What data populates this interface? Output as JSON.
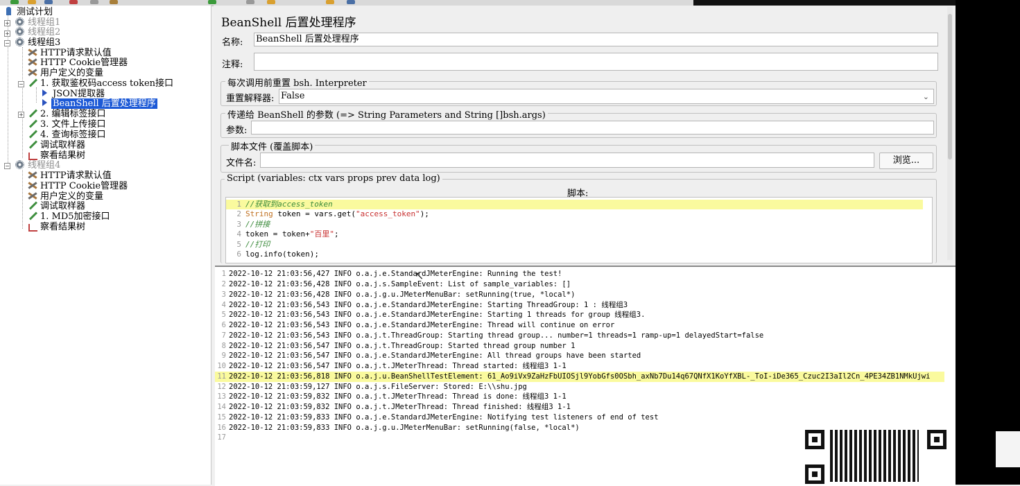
{
  "tree": {
    "items": [
      {
        "label": "测试计划",
        "icon": "test-plan-icon"
      },
      {
        "label": "线程组1",
        "icon": "gear-icon"
      },
      {
        "label": "线程组2",
        "icon": "gear-icon"
      },
      {
        "label": "线程组3",
        "icon": "gear-icon"
      },
      {
        "label": "HTTP请求默认值",
        "icon": "wrench-icon"
      },
      {
        "label": "HTTP Cookie管理器",
        "icon": "wrench-icon"
      },
      {
        "label": "用户定义的变量",
        "icon": "wrench-icon"
      },
      {
        "label": "1. 获取鉴权码access token接口",
        "icon": "sampler-icon"
      },
      {
        "label": "JSON提取器",
        "icon": "postprocessor-icon"
      },
      {
        "label": "BeanShell 后置处理程序",
        "icon": "postprocessor-icon"
      },
      {
        "label": "2. 编辑标签接口",
        "icon": "sampler-icon"
      },
      {
        "label": "3. 文件上传接口",
        "icon": "sampler-icon"
      },
      {
        "label": "4. 查询标签接口",
        "icon": "sampler-icon"
      },
      {
        "label": "调试取样器",
        "icon": "sampler-icon"
      },
      {
        "label": "察看结果树",
        "icon": "listener-icon"
      },
      {
        "label": "线程组4",
        "icon": "gear-icon"
      },
      {
        "label": "HTTP请求默认值",
        "icon": "wrench-icon"
      },
      {
        "label": "HTTP Cookie管理器",
        "icon": "wrench-icon"
      },
      {
        "label": "用户定义的变量",
        "icon": "wrench-icon"
      },
      {
        "label": "调试取样器",
        "icon": "sampler-icon"
      },
      {
        "label": "1. MD5加密接口",
        "icon": "sampler-icon"
      },
      {
        "label": "察看结果树",
        "icon": "listener-icon"
      }
    ],
    "selected_label": "BeanShell 后置处理程序"
  },
  "panel": {
    "title": "BeanShell 后置处理程序",
    "name_label": "名称:",
    "name_value": "BeanShell 后置处理程序",
    "comment_label": "注释:",
    "comment_value": "",
    "reset_group_title": "每次调用前重置 bsh. Interpreter",
    "reset_label": "重置解释器:",
    "reset_value": "False",
    "params_group_title": "传递给 BeanShell 的参数 (=> String Parameters and String []bsh.args)",
    "params_label": "参数:",
    "params_value": "",
    "file_group_title": "脚本文件 (覆盖脚本)",
    "file_label": "文件名:",
    "file_value": "",
    "browse_label": "浏览...",
    "script_group_title": "Script (variables: ctx vars props prev data log)",
    "script_label": "脚本:",
    "script_lines": [
      {
        "num": "1",
        "text": "//获取到access_token"
      },
      {
        "num": "2",
        "kw": "String",
        "text": " token = vars.get(",
        "str": "\"access_token\"",
        "tail": ");"
      },
      {
        "num": "3",
        "text": "//拼接"
      },
      {
        "num": "4",
        "text": "token = token+",
        "str": "\"百里\"",
        "tail": ";"
      },
      {
        "num": "5",
        "text": "//打印"
      },
      {
        "num": "6",
        "text": "log.info(token);"
      }
    ]
  },
  "log": {
    "lines": [
      "2022-10-12 21:03:56,427 INFO o.a.j.e.StandardJMeterEngine: Running the test!",
      "2022-10-12 21:03:56,428 INFO o.a.j.s.SampleEvent: List of sample_variables: []",
      "2022-10-12 21:03:56,428 INFO o.a.j.g.u.JMeterMenuBar: setRunning(true, *local*)",
      "2022-10-12 21:03:56,543 INFO o.a.j.e.StandardJMeterEngine: Starting ThreadGroup: 1 : 线程组3",
      "2022-10-12 21:03:56,543 INFO o.a.j.e.StandardJMeterEngine: Starting 1 threads for group 线程组3.",
      "2022-10-12 21:03:56,543 INFO o.a.j.e.StandardJMeterEngine: Thread will continue on error",
      "2022-10-12 21:03:56,543 INFO o.a.j.t.ThreadGroup: Starting thread group... number=1 threads=1 ramp-up=1 delayedStart=false",
      "2022-10-12 21:03:56,547 INFO o.a.j.t.ThreadGroup: Started thread group number 1",
      "2022-10-12 21:03:56,547 INFO o.a.j.e.StandardJMeterEngine: All thread groups have been started",
      "2022-10-12 21:03:56,547 INFO o.a.j.t.JMeterThread: Thread started: 线程组3 1-1",
      "2022-10-12 21:03:56,818 INFO o.a.j.u.BeanShellTestElement: 61_Ao9iVx9ZaHzFbUIOSjl9YobGfs0OSbh_axNb7Du14q67QNfX1KoYfXBL-_ToI-iDe365_Czuc2I3aIl2Cn_4PE34ZB1NMkUjwi",
      "2022-10-12 21:03:59,127 INFO o.a.j.s.FileServer: Stored: E:\\\\shu.jpg",
      "2022-10-12 21:03:59,832 INFO o.a.j.t.JMeterThread: Thread is done: 线程组3 1-1",
      "2022-10-12 21:03:59,832 INFO o.a.j.t.JMeterThread: Thread finished: 线程组3 1-1",
      "2022-10-12 21:03:59,833 INFO o.a.j.e.StandardJMeterEngine: Notifying test listeners of end of test",
      "2022-10-12 21:03:59,833 INFO o.a.j.g.u.JMeterMenuBar: setRunning(false, *local*)",
      ""
    ],
    "highlight_index": 10
  },
  "colors": {
    "selection": "#1c59d6",
    "highlight": "#fafa9e",
    "comment": "#3a8a3a",
    "string": "#c83030",
    "keyword": "#c07020"
  }
}
